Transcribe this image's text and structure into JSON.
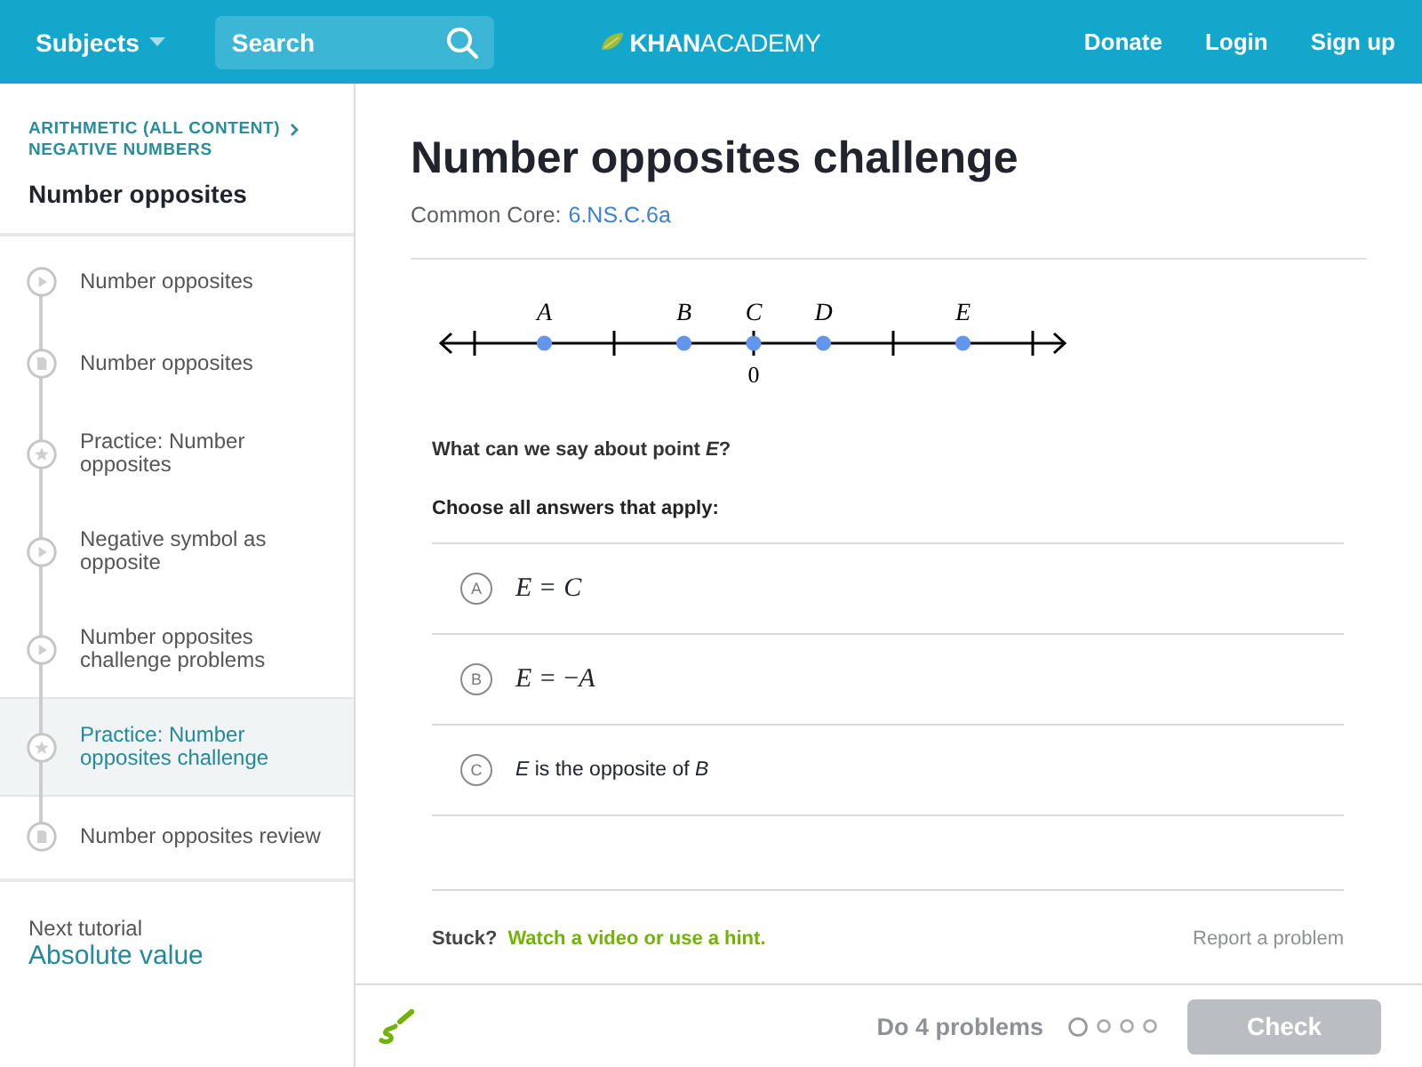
{
  "header": {
    "subjects": "Subjects",
    "search": {
      "placeholder": "Search"
    },
    "logo": "**KHAN**ACADEMY",
    "links": [
      "Donate",
      "Login",
      "Sign up"
    ]
  },
  "sidebar": {
    "breadcrumbs": [
      "ARITHMETIC (ALL CONTENT)",
      "NEGATIVE NUMBERS"
    ],
    "title": "Number opposites",
    "items": [
      {
        "kind": "video",
        "label": "Number opposites",
        "selected": false
      },
      {
        "kind": "article",
        "label": "Number opposites",
        "selected": false
      },
      {
        "kind": "exercise",
        "label": "Practice: Number opposites",
        "selected": false
      },
      {
        "kind": "video",
        "label": "Negative symbol as opposite",
        "selected": false
      },
      {
        "kind": "video",
        "label": "Number opposites challenge problems",
        "selected": false
      },
      {
        "kind": "exercise",
        "label": "Practice: Number opposites challenge",
        "selected": true
      },
      {
        "kind": "article",
        "label": "Number opposites review",
        "selected": false
      }
    ],
    "next": {
      "caption": "Next tutorial",
      "link": "Absolute value"
    }
  },
  "main": {
    "title": "Number opposites challenge",
    "standard": {
      "label": "Common Core:",
      "link": "6.NS.C.6a"
    },
    "number_line": {
      "points": [
        {
          "label": "A"
        },
        {
          "label": "B"
        },
        {
          "label": "C"
        },
        {
          "label": "D"
        },
        {
          "label": "E"
        }
      ],
      "tick_labels": [
        "0"
      ]
    },
    "question": "What can we say about point *E*?",
    "instruction": "Choose all answers that apply:",
    "choices": [
      {
        "letter": "A",
        "kind": "math",
        "text": "*E* = *C*",
        "selected": false
      },
      {
        "letter": "B",
        "kind": "math",
        "text": "*E* = −*A*",
        "selected": false
      },
      {
        "letter": "C",
        "kind": "text",
        "text": "*E* is the opposite of *B*",
        "selected": false
      }
    ],
    "help": {
      "prompt": "Stuck?",
      "link": "Watch a video or use a hint.",
      "report": "Report a problem"
    }
  },
  "footer": {
    "task": "Do 4 problems",
    "progress": [
      {
        "current": true
      },
      {
        "current": false
      },
      {
        "current": false
      },
      {
        "current": false
      }
    ],
    "check": {
      "label": "Check",
      "disabled": true
    }
  }
}
